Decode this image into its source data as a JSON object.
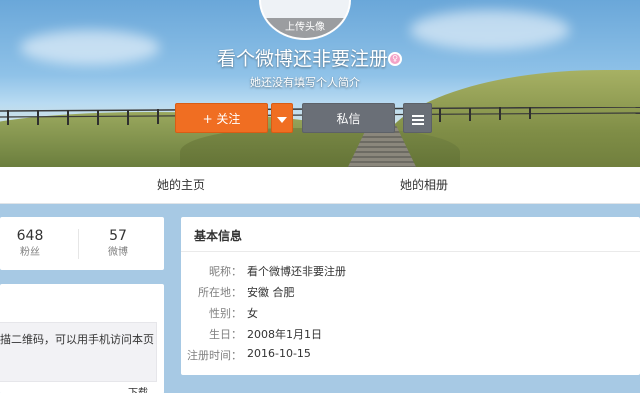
{
  "profile": {
    "avatar_upload_label": "上传头像",
    "nickname": "看个微博还非要注册",
    "intro": "她还没有填写个人简介",
    "follow_label": "+ 关注",
    "message_label": "私信"
  },
  "tabs": [
    {
      "label": "她的主页"
    },
    {
      "label": "她的相册"
    }
  ],
  "stats": [
    {
      "value": "648",
      "label": "粉丝"
    },
    {
      "value": "57",
      "label": "微博"
    }
  ],
  "qr": {
    "text": "扫描二维码，可以用手机访问本页",
    "download": "下载"
  },
  "basic_info": {
    "title": "基本信息",
    "rows": [
      {
        "label": "昵称：",
        "value": "看个微博还非要注册"
      },
      {
        "label": "所在地：",
        "value": "安徽 合肥"
      },
      {
        "label": "性别：",
        "value": "女"
      },
      {
        "label": "生日：",
        "value": "2008年1月1日"
      },
      {
        "label": "注册时间：",
        "value": "2016-10-15"
      }
    ]
  },
  "colors": {
    "follow_button": "#f06e22",
    "message_button": "#6a6f77",
    "page_background": "#a7c9e4",
    "gender_female": "#f4a3c7"
  },
  "icons": {
    "gender": "female-gender-icon",
    "dropdown": "chevron-down-icon",
    "more": "menu-icon"
  }
}
